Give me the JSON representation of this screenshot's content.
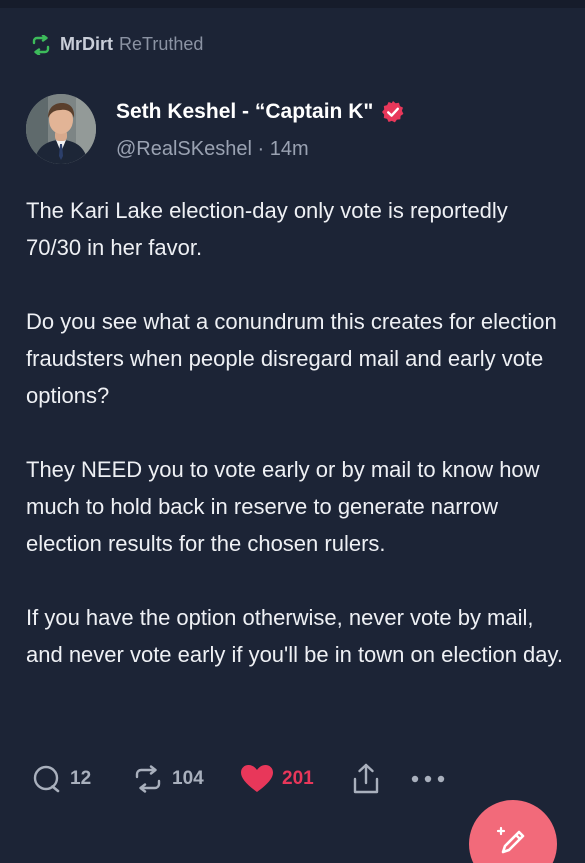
{
  "retruth": {
    "user": "MrDirt",
    "label": "ReTruthed"
  },
  "author": {
    "display_name": "Seth Keshel - “Captain K\"",
    "handle": "@RealSKeshel",
    "time": "· 14m",
    "verified": true
  },
  "post": {
    "paragraphs": [
      "The Kari Lake election-day only vote is reportedly 70/30 in her favor.",
      "Do you see what a conundrum this creates for election fraudsters when people disregard mail and early vote options?",
      "They NEED you to vote early or by mail to know how much to hold back in reserve to generate narrow election results for the chosen rulers.",
      "If you have the option otherwise, never vote by mail, and never vote early if you'll be in town on election day."
    ]
  },
  "actions": {
    "replies": "12",
    "retruths": "104",
    "likes": "201",
    "liked": true,
    "reply_icon": "reply-bubble-icon",
    "retruth_icon": "retruth-arrows-icon",
    "like_icon": "heart-icon",
    "share_icon": "share-upload-icon",
    "more_icon": "more-dots-icon"
  },
  "compose": {
    "icon": "compose-pen-icon"
  },
  "colors": {
    "background": "#1c2436",
    "retruth_green": "#3dbb5b",
    "like_red": "#e8375a",
    "verified_pink": "#e8375a",
    "fab_pink": "#f26a7a"
  }
}
